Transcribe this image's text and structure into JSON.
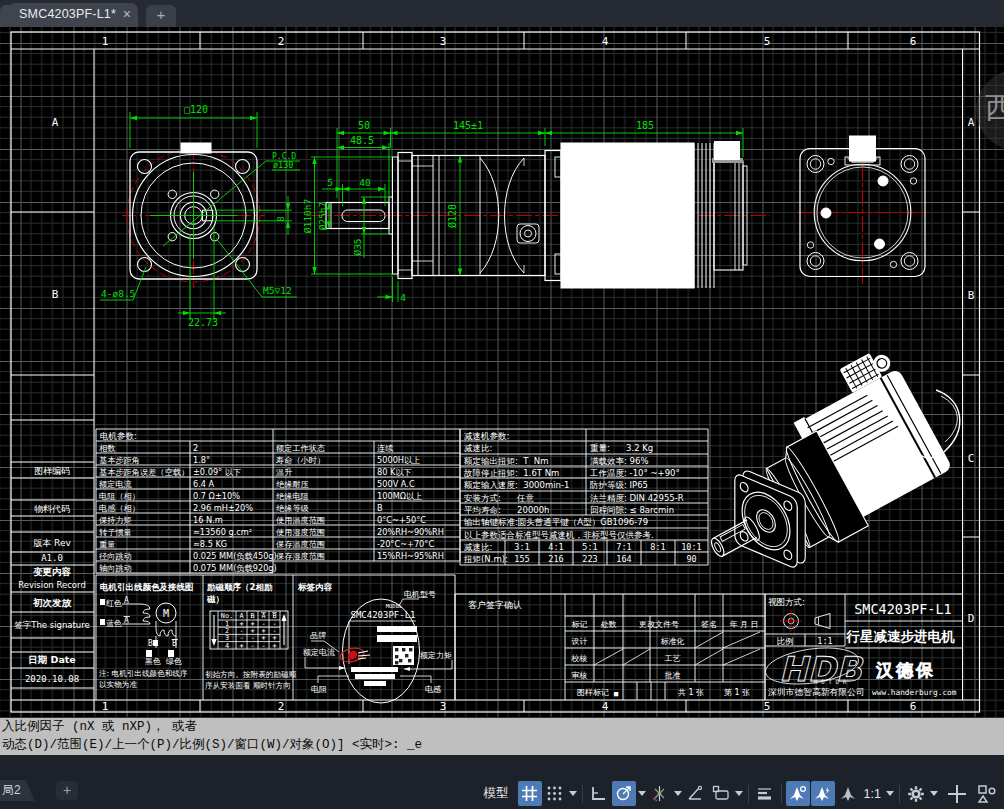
{
  "tab_bar": {
    "document_tab": "SMC4203PF-L1*",
    "close_icon": "×",
    "new_tab_icon": "+"
  },
  "command_line": {
    "line1": "入比例因子 (nX 或 nXP)， 或者",
    "line2": "动态(D)/范围(E)/上一个(P)/比例(S)/窗口(W)/对象(O)] <实时>: _e"
  },
  "status_bar": {
    "layout_tab": "局2",
    "new_layout_icon": "+",
    "model_button": "模型",
    "scale_value": "1:1",
    "grid_color": "#4e7ab5"
  },
  "sheet": {
    "column_labels": [
      "1",
      "2",
      "3",
      "4",
      "5",
      "6"
    ],
    "left_row_labels": [
      "A",
      "B"
    ],
    "right_row_labels": [
      "A",
      "B",
      "C",
      "D"
    ],
    "watermark": "西",
    "line_color": "#ffffff",
    "dim_color": "#00e000",
    "center_color": "#b40000"
  },
  "revision_block": {
    "drawing_code_label": "图样编码",
    "material_code_label": "物料代码",
    "version_label": "版本 Rev",
    "version_value": "A1.0",
    "change_label_cn": "变更内容",
    "change_label_en": "Revision Record",
    "first_release": "初次发放",
    "signature_label": "签字The signature",
    "date_label": "日期 Date",
    "date_value": "2020.10.08"
  },
  "front_view": {
    "square_dim": "□120",
    "pcd_line1": "P.C.D",
    "pcd_line2": "ø130",
    "holes_dim": "4-ø8.5",
    "tap_dim": "M5▽12",
    "keyway_offset_dim": "22.73",
    "keyway_width_dim": "8"
  },
  "side_view": {
    "shaft_total_dim": "50",
    "shaft_step_dim": "48.5",
    "key_start_dim": "5",
    "key_length_dim": "40",
    "pilot_dia_dim": "Ø110h7",
    "shaft_dia_dim": "Ø25h7",
    "collar_dia_dim": "Ø35",
    "body_dia_dim": "Ø120",
    "gearbox_length_dim": "145±1",
    "motor_length_dim": "185",
    "flange_thickness_dim": "4"
  },
  "motor_table": {
    "title": "电机参数:",
    "rows_left": [
      [
        "相数",
        "2"
      ],
      [
        "基本步距角",
        "1.8°"
      ],
      [
        "基本步距角误差（空载）",
        "±0.09° 以下"
      ],
      [
        "额定电流",
        "6.4 A"
      ],
      [
        "电阻（相）",
        "0.7 Ω±10%"
      ],
      [
        "电感（相）",
        "2.96 mH±20%"
      ],
      [
        "保持力矩",
        "16 N.m"
      ],
      [
        "转子惯量",
        "≈13560 g.cm²"
      ],
      [
        "重量",
        "≈8.5 KG"
      ],
      [
        "径向跳动",
        "0.025 MM(负载450g)"
      ],
      [
        "轴向跳动",
        "0.075 MM(负载920g)"
      ]
    ],
    "rows_right": [
      [
        "额定工作状态",
        "连续"
      ],
      [
        "寿命（小时）",
        "5000H以上"
      ],
      [
        "温升",
        "80 K以下"
      ],
      [
        "绝缘耐压",
        "500V A.C"
      ],
      [
        "绝缘电阻",
        "100MΩ以上"
      ],
      [
        "绝缘等级",
        "B"
      ],
      [
        "使用温度范围",
        "0°C~+50°C"
      ],
      [
        "使用湿度范围",
        "20%RH~90%RH"
      ],
      [
        "保存温度范围",
        "-20°C~+70°C"
      ],
      [
        "保存湿度范围",
        "15%RH~95%RH"
      ]
    ]
  },
  "reducer_table": {
    "title": "减速机参数:",
    "rows_left": [
      "减速比:",
      "额定输出扭矩:  T  Nm",
      "故障停止扭矩:  1.6T Nm",
      "额定输入速度:  3000min-1",
      "安装方式:      任意",
      "平均寿命:      20000h"
    ],
    "rows_right": [
      "重量:      3.2 Kg",
      "满载效率: 96%",
      "工作温度: -10° ~+90°",
      "防护等级: IP65",
      "法兰精度: DIN 42955-R",
      "回程间隙: ≤ 8arcmin"
    ],
    "note1": "输出轴键标准:圆头普通平键（A型）GB1096-79",
    "note2": "以上参数适合标准型号减速机，非标型号仅供参考.",
    "ratio_label": "减速比:",
    "ratio_values": [
      "3:1",
      "4:1",
      "5:1",
      "7:1",
      "8:1",
      "10:1"
    ],
    "torque_label": "扭矩(N.m):",
    "torque_values": [
      "155",
      "216",
      "223",
      "164",
      "",
      "90"
    ]
  },
  "wiring_panel": {
    "title": "电机引出线颜色及接线图",
    "wire_red": "红色",
    "wire_blue": "蓝色",
    "wire_black": "黑色",
    "wire_green": "绿色",
    "phase_a": "A",
    "phase_a_bar": "A",
    "phase_b": "B",
    "phase_b_bar": "B",
    "motor_symbol": "M",
    "note1": "注: 电机引出线颜色和线序",
    "note2": "以实物为准"
  },
  "excitation_panel": {
    "title1": "励磁顺序（2相励",
    "title2": "磁）",
    "headers": [
      "No.",
      "A",
      "B",
      "A",
      "B"
    ],
    "rows": [
      [
        "1",
        "+",
        "+",
        "-",
        "-"
      ],
      [
        "2",
        "-",
        "+",
        "+",
        "-"
      ],
      [
        "3",
        "-",
        "-",
        "+",
        "+"
      ],
      [
        "4",
        "+",
        "-",
        "-",
        "+"
      ]
    ],
    "note1": "初始方向。按附表的励磁顺",
    "note2": "序从安装面看 顺时针方向"
  },
  "label_panel": {
    "title": "标签内容",
    "model_caption": "MODEL",
    "model_value": "SMC4203PF-L1",
    "callout_model": "电机型号",
    "callout_brand": "品牌",
    "callout_current": "额定电流",
    "callout_torque": "额定力矩",
    "callout_resistance": "电阻",
    "callout_inductance": "电感"
  },
  "signature_block": {
    "title": "客户签字确认"
  },
  "approval_table": {
    "headers": [
      "标记",
      "处数",
      "更改文件号",
      "签名",
      "年 月 日"
    ],
    "row_design": "设计",
    "row_check": "校核",
    "row_review": "审核",
    "row_standard": "标准化",
    "row_process": "工艺",
    "row_approve": "批准",
    "footer_mark": "图样标记",
    "footer_square": "■",
    "sheets_total": "共 1 张",
    "sheet_no": "第 1 张"
  },
  "title_block": {
    "view_method_label": "视图方式:",
    "scale_label": "比例",
    "scale_value": "1:1",
    "model": "SMC4203PF-L1",
    "product_name": "行星减速步进电机",
    "logo_text": "HDB",
    "logo_sub": "M O T O R",
    "brand_cn": "汉德保",
    "company": "深圳市德智高新有限公司",
    "website": "www.handerburg.com"
  }
}
